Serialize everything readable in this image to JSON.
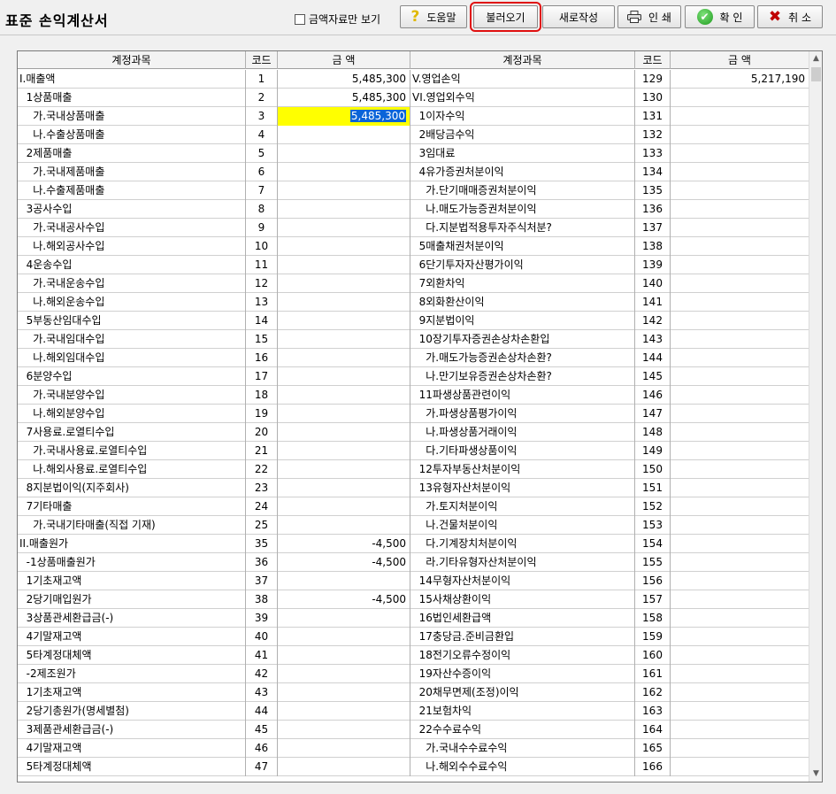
{
  "window": {
    "title": "표준 손익계산서"
  },
  "toolbar": {
    "amount_only_label": "금액자료만 보기",
    "help_label": "도움말",
    "load_label": "불러오기",
    "new_label": "새로작성",
    "print_label": "인 쇄",
    "ok_label": "확 인",
    "cancel_label": "취 소"
  },
  "grid": {
    "headers": [
      "계정과목",
      "코드",
      "금 액",
      "계정과목",
      "코드",
      "금 액"
    ],
    "left": [
      {
        "name": "I.매출액",
        "code": "1",
        "amount": "5,485,300"
      },
      {
        "name": "  1상품매출",
        "code": "2",
        "amount": "5,485,300"
      },
      {
        "name": "    가.국내상품매출",
        "code": "3",
        "amount": "5,485,300",
        "selected": true
      },
      {
        "name": "    나.수출상품매출",
        "code": "4",
        "amount": ""
      },
      {
        "name": "  2제품매출",
        "code": "5",
        "amount": ""
      },
      {
        "name": "    가.국내제품매출",
        "code": "6",
        "amount": ""
      },
      {
        "name": "    나.수출제품매출",
        "code": "7",
        "amount": ""
      },
      {
        "name": "  3공사수입",
        "code": "8",
        "amount": ""
      },
      {
        "name": "    가.국내공사수입",
        "code": "9",
        "amount": ""
      },
      {
        "name": "    나.해외공사수입",
        "code": "10",
        "amount": ""
      },
      {
        "name": "  4운송수입",
        "code": "11",
        "amount": ""
      },
      {
        "name": "    가.국내운송수입",
        "code": "12",
        "amount": ""
      },
      {
        "name": "    나.해외운송수입",
        "code": "13",
        "amount": ""
      },
      {
        "name": "  5부동산임대수입",
        "code": "14",
        "amount": ""
      },
      {
        "name": "    가.국내임대수입",
        "code": "15",
        "amount": ""
      },
      {
        "name": "    나.해외임대수입",
        "code": "16",
        "amount": ""
      },
      {
        "name": "  6분양수입",
        "code": "17",
        "amount": ""
      },
      {
        "name": "    가.국내분양수입",
        "code": "18",
        "amount": ""
      },
      {
        "name": "    나.해외분양수입",
        "code": "19",
        "amount": ""
      },
      {
        "name": "  7사용료.로열티수입",
        "code": "20",
        "amount": ""
      },
      {
        "name": "    가.국내사용료.로열티수입",
        "code": "21",
        "amount": ""
      },
      {
        "name": "    나.해외사용료.로열티수입",
        "code": "22",
        "amount": ""
      },
      {
        "name": "  8지분법이익(지주회사)",
        "code": "23",
        "amount": ""
      },
      {
        "name": "  7기타매출",
        "code": "24",
        "amount": ""
      },
      {
        "name": "    가.국내기타매출(직접 기재)",
        "code": "25",
        "amount": ""
      },
      {
        "name": "II.매출원가",
        "code": "35",
        "amount": "-4,500"
      },
      {
        "name": "  -1상품매출원가",
        "code": "36",
        "amount": "-4,500"
      },
      {
        "name": "  1기초재고액",
        "code": "37",
        "amount": ""
      },
      {
        "name": "  2당기매입원가",
        "code": "38",
        "amount": "-4,500"
      },
      {
        "name": "  3상품관세환급금(-)",
        "code": "39",
        "amount": ""
      },
      {
        "name": "  4기말재고액",
        "code": "40",
        "amount": ""
      },
      {
        "name": "  5타계정대체액",
        "code": "41",
        "amount": ""
      },
      {
        "name": "  -2제조원가",
        "code": "42",
        "amount": ""
      },
      {
        "name": "  1기초재고액",
        "code": "43",
        "amount": ""
      },
      {
        "name": "  2당기총원가(명세별첨)",
        "code": "44",
        "amount": ""
      },
      {
        "name": "  3제품관세환급금(-)",
        "code": "45",
        "amount": ""
      },
      {
        "name": "  4기말재고액",
        "code": "46",
        "amount": ""
      },
      {
        "name": "  5타계정대체액",
        "code": "47",
        "amount": ""
      }
    ],
    "right": [
      {
        "name": "V.영업손익",
        "code": "129",
        "amount": "5,217,190"
      },
      {
        "name": "VI.영업외수익",
        "code": "130",
        "amount": ""
      },
      {
        "name": "  1이자수익",
        "code": "131",
        "amount": ""
      },
      {
        "name": "  2배당금수익",
        "code": "132",
        "amount": ""
      },
      {
        "name": "  3임대료",
        "code": "133",
        "amount": ""
      },
      {
        "name": "  4유가증권처분이익",
        "code": "134",
        "amount": ""
      },
      {
        "name": "    가.단기매매증권처분이익",
        "code": "135",
        "amount": ""
      },
      {
        "name": "    나.매도가능증권처분이익",
        "code": "136",
        "amount": ""
      },
      {
        "name": "    다.지분법적용투자주식처분?",
        "code": "137",
        "amount": ""
      },
      {
        "name": "  5매출채권처분이익",
        "code": "138",
        "amount": ""
      },
      {
        "name": "  6단기투자자산평가이익",
        "code": "139",
        "amount": ""
      },
      {
        "name": "  7외환차익",
        "code": "140",
        "amount": ""
      },
      {
        "name": "  8외화환산이익",
        "code": "141",
        "amount": ""
      },
      {
        "name": "  9지분법이익",
        "code": "142",
        "amount": ""
      },
      {
        "name": "  10장기투자증권손상차손환입",
        "code": "143",
        "amount": ""
      },
      {
        "name": "    가.매도가능증권손상차손환?",
        "code": "144",
        "amount": ""
      },
      {
        "name": "    나.만기보유증권손상차손환?",
        "code": "145",
        "amount": ""
      },
      {
        "name": "  11파생상품관련이익",
        "code": "146",
        "amount": ""
      },
      {
        "name": "    가.파생상품평가이익",
        "code": "147",
        "amount": ""
      },
      {
        "name": "    나.파생상품거래이익",
        "code": "148",
        "amount": ""
      },
      {
        "name": "    다.기타파생상품이익",
        "code": "149",
        "amount": ""
      },
      {
        "name": "  12투자부동산처분이익",
        "code": "150",
        "amount": ""
      },
      {
        "name": "  13유형자산처분이익",
        "code": "151",
        "amount": ""
      },
      {
        "name": "    가.토지처분이익",
        "code": "152",
        "amount": ""
      },
      {
        "name": "    나.건물처분이익",
        "code": "153",
        "amount": ""
      },
      {
        "name": "    다.기계장치처분이익",
        "code": "154",
        "amount": ""
      },
      {
        "name": "    라.기타유형자산처분이익",
        "code": "155",
        "amount": ""
      },
      {
        "name": "  14무형자산처분이익",
        "code": "156",
        "amount": ""
      },
      {
        "name": "  15사채상환이익",
        "code": "157",
        "amount": ""
      },
      {
        "name": "  16법인세환급액",
        "code": "158",
        "amount": ""
      },
      {
        "name": "  17충당금.준비금환입",
        "code": "159",
        "amount": ""
      },
      {
        "name": "  18전기오류수정이익",
        "code": "160",
        "amount": ""
      },
      {
        "name": "  19자산수증이익",
        "code": "161",
        "amount": ""
      },
      {
        "name": "  20채무면제(조정)이익",
        "code": "162",
        "amount": ""
      },
      {
        "name": "  21보험차익",
        "code": "163",
        "amount": ""
      },
      {
        "name": "  22수수료수익",
        "code": "164",
        "amount": ""
      },
      {
        "name": "    가.국내수수료수익",
        "code": "165",
        "amount": ""
      },
      {
        "name": "    나.해외수수료수익",
        "code": "166",
        "amount": ""
      }
    ]
  }
}
